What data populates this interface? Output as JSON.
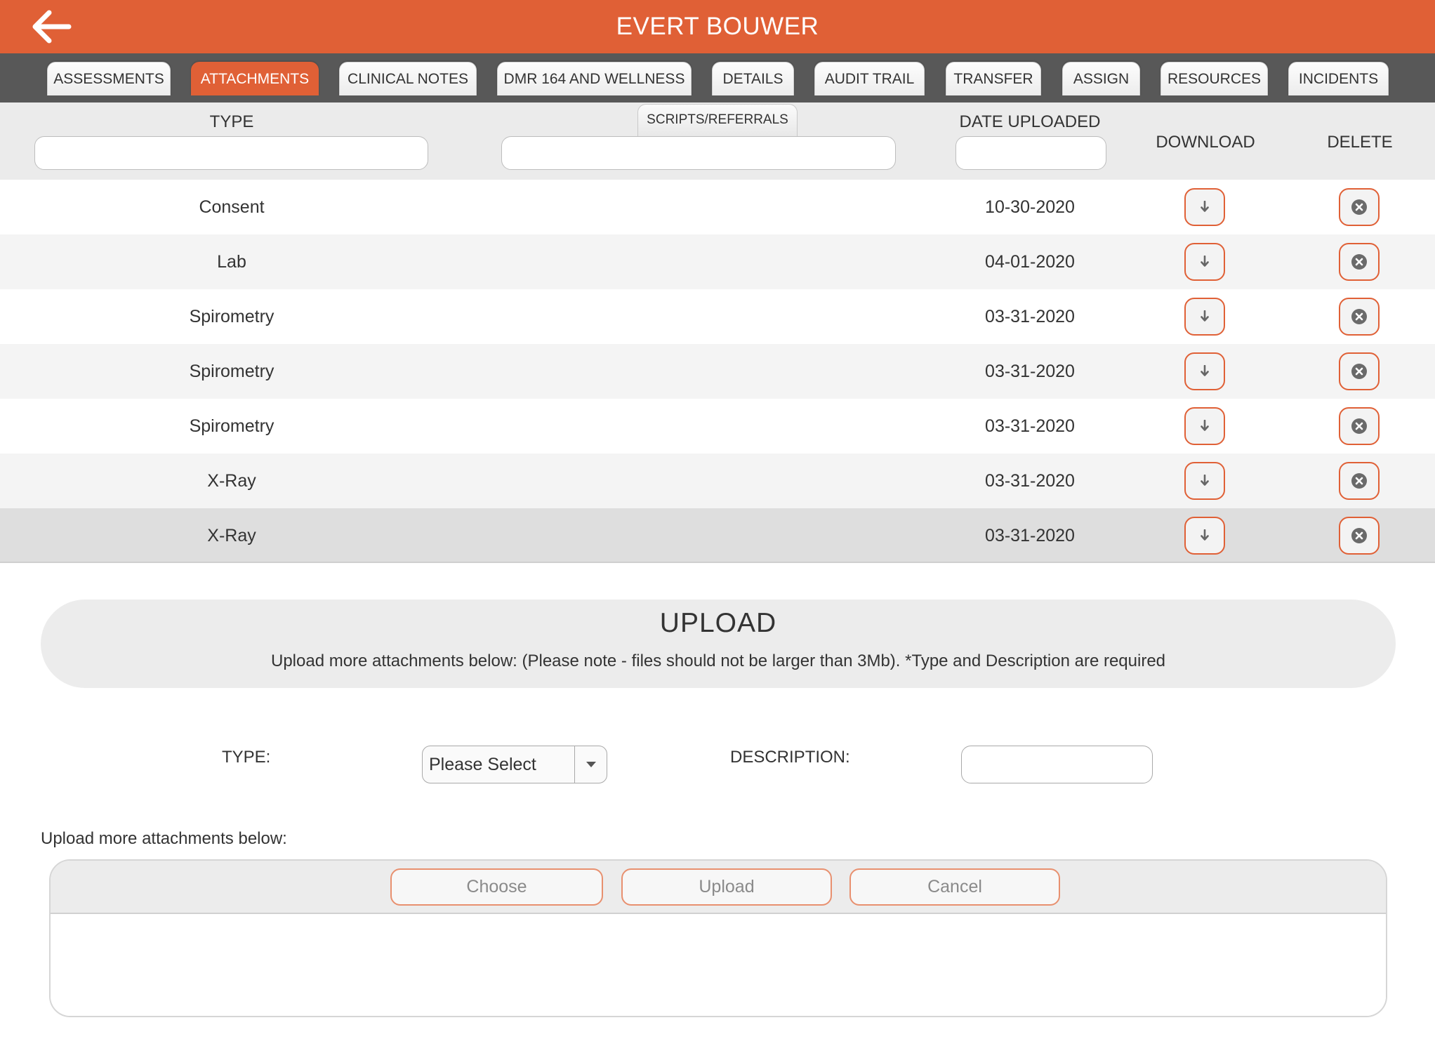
{
  "header": {
    "title": "EVERT BOUWER",
    "back_icon": "arrow-left-icon"
  },
  "tabs": [
    {
      "label": "ASSESSMENTS",
      "active": false
    },
    {
      "label": "ATTACHMENTS",
      "active": true
    },
    {
      "label": "CLINICAL NOTES",
      "active": false
    },
    {
      "label": "DMR 164 AND WELLNESS",
      "active": false
    },
    {
      "label": "DETAILS",
      "active": false
    },
    {
      "label": "AUDIT TRAIL",
      "active": false
    },
    {
      "label": "TRANSFER",
      "active": false
    },
    {
      "label": "ASSIGN",
      "active": false
    },
    {
      "label": "RESOURCES",
      "active": false
    },
    {
      "label": "INCIDENTS",
      "active": false
    }
  ],
  "table": {
    "columns": {
      "type": "TYPE",
      "subtab": "SCRIPTS/REFERRALS",
      "date": "DATE UPLOADED",
      "download": "DOWNLOAD",
      "delete": "DELETE"
    },
    "filters": {
      "type": "",
      "description": "",
      "date": ""
    },
    "rows": [
      {
        "type": "Consent",
        "date": "10-30-2020"
      },
      {
        "type": "Lab",
        "date": "04-01-2020"
      },
      {
        "type": "Spirometry",
        "date": "03-31-2020"
      },
      {
        "type": "Spirometry",
        "date": "03-31-2020"
      },
      {
        "type": "Spirometry",
        "date": "03-31-2020"
      },
      {
        "type": "X-Ray",
        "date": "03-31-2020"
      },
      {
        "type": "X-Ray",
        "date": "03-31-2020"
      }
    ],
    "download_icon": "download-arrow-icon",
    "delete_icon": "close-circle-icon"
  },
  "upload": {
    "title": "UPLOAD",
    "note": "Upload more attachments below: (Please note - files should not be larger than 3Mb). *Type and Description are required"
  },
  "form": {
    "type_label": "TYPE:",
    "type_value": "Please Select",
    "description_label": "DESCRIPTION:",
    "description_value": "",
    "more_label": "Upload more attachments below:"
  },
  "file_upload": {
    "choose": "Choose",
    "upload": "Upload",
    "cancel": "Cancel"
  },
  "colors": {
    "accent": "#e06036",
    "tabbar": "#585858",
    "filter_bg": "#ebebeb"
  }
}
